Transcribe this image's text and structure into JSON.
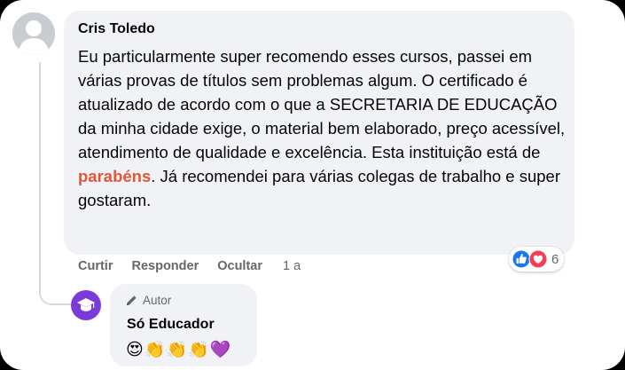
{
  "comment": {
    "author": "Cris Toledo",
    "text_before_mention": "Eu particularmente super recomendo esses cursos, passei em várias provas de títulos sem problemas algum. O certificado é atualizado de acordo com o que a SECRETARIA DE EDUCAÇÃO da minha cidade exige, o material bem elaborado, preço acessível, atendimento de qualidade e excelência. Esta instituição está de ",
    "mention": "parabéns",
    "text_after_mention": ". Já recomendei para várias colegas de trabalho e super gostaram.",
    "reactions": {
      "icons": [
        "like-icon",
        "love-icon"
      ],
      "count": "6"
    },
    "actions": {
      "like": "Curtir",
      "reply": "Responder",
      "hide": "Ocultar",
      "timestamp": "1 a"
    }
  },
  "reply": {
    "badge": "Autor",
    "author": "Só Educador",
    "emojis": "😍👏👏👏💜"
  },
  "colors": {
    "bubble": "#f0f2f5",
    "mention": "#e0573a",
    "like_blue": "#1877f2",
    "love_red": "#f33e58",
    "reply_avatar": "#7c3ad8",
    "secondary_text": "#65676b"
  }
}
